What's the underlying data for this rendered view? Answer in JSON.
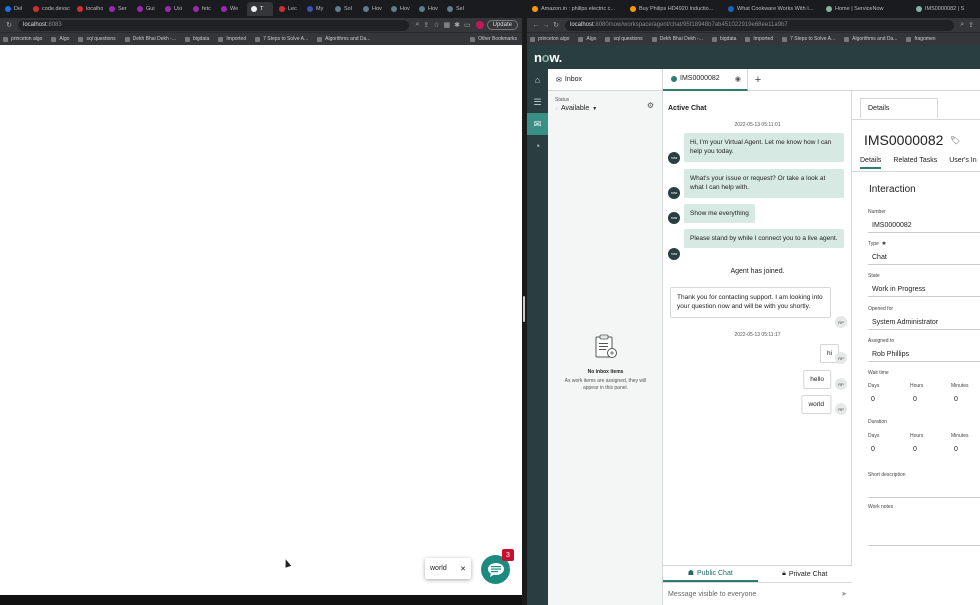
{
  "left_browser": {
    "tabs": [
      {
        "label": "Del",
        "color": "#1a73e8"
      },
      {
        "label": "code.devsc",
        "color": "#d32f2f"
      },
      {
        "label": "localhost",
        "color": "#d32f2f"
      },
      {
        "label": "Ser",
        "color": "#9c27b0"
      },
      {
        "label": "Gui",
        "color": "#9c27b0"
      },
      {
        "label": "Usi",
        "color": "#9c27b0"
      },
      {
        "label": "fetc",
        "color": "#9c27b0"
      },
      {
        "label": "We",
        "color": "#9c27b0"
      },
      {
        "label": "T",
        "color": "#eeeeee"
      },
      {
        "label": "Lec",
        "color": "#d32f2f"
      },
      {
        "label": "My",
        "color": "#3f51b5"
      },
      {
        "label": "Sol",
        "color": "#607d8b"
      },
      {
        "label": "Hov",
        "color": "#607d8b"
      },
      {
        "label": "Hov",
        "color": "#607d8b"
      },
      {
        "label": "Hov",
        "color": "#607d8b"
      },
      {
        "label": "Sel",
        "color": "#607d8b"
      }
    ],
    "url": "localhost",
    "url_port": ":8083",
    "update_label": "Update",
    "bookmarks": [
      "princeton algo",
      "Algo",
      "sql questions",
      "Dekh Bhai Dekh -...",
      "bigdata",
      "Imported",
      "7 Steps to Solve A...",
      "Algorithms and Da..."
    ],
    "other_bookmarks": "Other Bookmarks",
    "widget": {
      "preview_text": "world",
      "badge_count": "3"
    }
  },
  "right_browser": {
    "tabs": [
      {
        "label": "Amazon.in : philips electric c...",
        "color": "#ff9800"
      },
      {
        "label": "Buy Philips HD4920 Inductio...",
        "color": "#ff9800"
      },
      {
        "label": "What Cookware Works With I...",
        "color": "#1565c0"
      },
      {
        "label": "Home | ServiceNow",
        "color": "#81b5a1"
      },
      {
        "label": "IMS0000082 | S",
        "color": "#81b5a1"
      }
    ],
    "url": "localhost",
    "url_rest": ":8080/now/workspace/agent/chat/95f18948b7ab451022919e68ee11a9b7",
    "bookmarks": [
      "princeton algo",
      "Algo",
      "sql questions",
      "Dekh Bhai Dekh -...",
      "bigdata",
      "Imported",
      "7 Steps to Solve A...",
      "Algorithms and Da...",
      "fragomen"
    ]
  },
  "servicenow": {
    "logo_prefix": "n",
    "logo_o": "o",
    "logo_suffix": "w.",
    "inbox": {
      "title": "Inbox",
      "status_label": "Status",
      "status_value": "Available",
      "empty_title": "No inbox items",
      "empty_sub": "As work items are assigned, they will appear in this panel."
    },
    "chat_tab": "IMS0000082",
    "chat": {
      "title": "Active Chat",
      "timestamp1": "2022-05-13 05:11:01",
      "va_messages": [
        "Hi, I'm your Virtual Agent. Let me know how I can help you today.",
        "What's your issue or request? Or take a look at what I can help with.",
        "Show me everything",
        "Please stand by while I connect you to a live agent."
      ],
      "system_message": "Agent has joined.",
      "agent_message": "Thank you for contacting support. I am looking into your question now and will be with you shortly.",
      "timestamp2": "2022-05-13 05:11:17",
      "user_messages": [
        "hi",
        "hello",
        "world"
      ],
      "initials": "RP",
      "bot_label": "now",
      "public_chat": "Public Chat",
      "private_chat": "Private Chat",
      "composer_placeholder": "Message visible to everyone"
    },
    "details": {
      "tab": "Details",
      "record_number": "IMS0000082",
      "tabs": [
        "Details",
        "Related Tasks",
        "User's In"
      ],
      "section_title": "Interaction",
      "fields": {
        "number_label": "Number",
        "number": "IMS0000082",
        "type_label": "Type",
        "type": "Chat",
        "state_label": "State",
        "state": "Work in Progress",
        "opened_for_label": "Opened for",
        "opened_for": "System Administrator",
        "assigned_to_label": "Assigned to",
        "assigned_to": "Rob Phillips",
        "wait_time_label": "Wait time",
        "duration_label": "Duration",
        "days_label": "Days",
        "hours_label": "Hours",
        "minutes_label": "Minutes",
        "wait_days": "0",
        "wait_hours": "0",
        "wait_minutes": "0",
        "dur_days": "0",
        "dur_hours": "0",
        "dur_minutes": "0",
        "short_desc_label": "Short description",
        "work_notes_label": "Work notes"
      }
    }
  }
}
